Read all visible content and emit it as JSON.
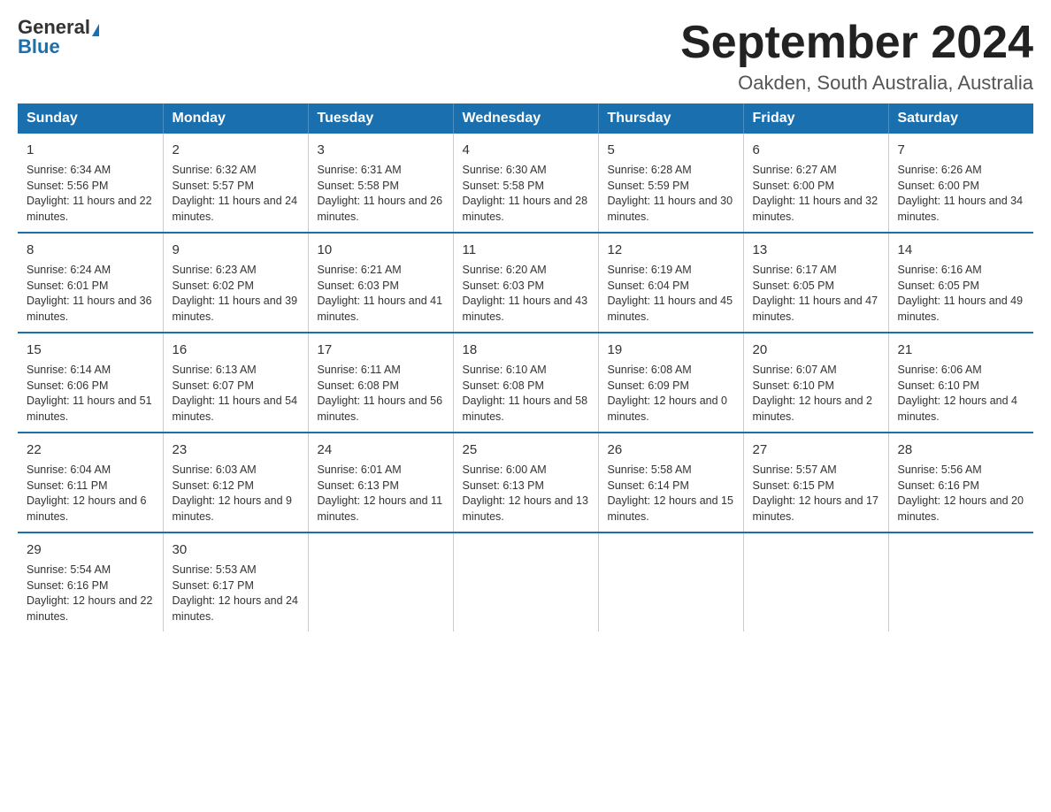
{
  "logo": {
    "general": "General",
    "blue": "Blue"
  },
  "title": "September 2024",
  "location": "Oakden, South Australia, Australia",
  "days_header": [
    "Sunday",
    "Monday",
    "Tuesday",
    "Wednesday",
    "Thursday",
    "Friday",
    "Saturday"
  ],
  "weeks": [
    [
      {
        "day": "1",
        "sunrise": "6:34 AM",
        "sunset": "5:56 PM",
        "daylight": "11 hours and 22 minutes."
      },
      {
        "day": "2",
        "sunrise": "6:32 AM",
        "sunset": "5:57 PM",
        "daylight": "11 hours and 24 minutes."
      },
      {
        "day": "3",
        "sunrise": "6:31 AM",
        "sunset": "5:58 PM",
        "daylight": "11 hours and 26 minutes."
      },
      {
        "day": "4",
        "sunrise": "6:30 AM",
        "sunset": "5:58 PM",
        "daylight": "11 hours and 28 minutes."
      },
      {
        "day": "5",
        "sunrise": "6:28 AM",
        "sunset": "5:59 PM",
        "daylight": "11 hours and 30 minutes."
      },
      {
        "day": "6",
        "sunrise": "6:27 AM",
        "sunset": "6:00 PM",
        "daylight": "11 hours and 32 minutes."
      },
      {
        "day": "7",
        "sunrise": "6:26 AM",
        "sunset": "6:00 PM",
        "daylight": "11 hours and 34 minutes."
      }
    ],
    [
      {
        "day": "8",
        "sunrise": "6:24 AM",
        "sunset": "6:01 PM",
        "daylight": "11 hours and 36 minutes."
      },
      {
        "day": "9",
        "sunrise": "6:23 AM",
        "sunset": "6:02 PM",
        "daylight": "11 hours and 39 minutes."
      },
      {
        "day": "10",
        "sunrise": "6:21 AM",
        "sunset": "6:03 PM",
        "daylight": "11 hours and 41 minutes."
      },
      {
        "day": "11",
        "sunrise": "6:20 AM",
        "sunset": "6:03 PM",
        "daylight": "11 hours and 43 minutes."
      },
      {
        "day": "12",
        "sunrise": "6:19 AM",
        "sunset": "6:04 PM",
        "daylight": "11 hours and 45 minutes."
      },
      {
        "day": "13",
        "sunrise": "6:17 AM",
        "sunset": "6:05 PM",
        "daylight": "11 hours and 47 minutes."
      },
      {
        "day": "14",
        "sunrise": "6:16 AM",
        "sunset": "6:05 PM",
        "daylight": "11 hours and 49 minutes."
      }
    ],
    [
      {
        "day": "15",
        "sunrise": "6:14 AM",
        "sunset": "6:06 PM",
        "daylight": "11 hours and 51 minutes."
      },
      {
        "day": "16",
        "sunrise": "6:13 AM",
        "sunset": "6:07 PM",
        "daylight": "11 hours and 54 minutes."
      },
      {
        "day": "17",
        "sunrise": "6:11 AM",
        "sunset": "6:08 PM",
        "daylight": "11 hours and 56 minutes."
      },
      {
        "day": "18",
        "sunrise": "6:10 AM",
        "sunset": "6:08 PM",
        "daylight": "11 hours and 58 minutes."
      },
      {
        "day": "19",
        "sunrise": "6:08 AM",
        "sunset": "6:09 PM",
        "daylight": "12 hours and 0 minutes."
      },
      {
        "day": "20",
        "sunrise": "6:07 AM",
        "sunset": "6:10 PM",
        "daylight": "12 hours and 2 minutes."
      },
      {
        "day": "21",
        "sunrise": "6:06 AM",
        "sunset": "6:10 PM",
        "daylight": "12 hours and 4 minutes."
      }
    ],
    [
      {
        "day": "22",
        "sunrise": "6:04 AM",
        "sunset": "6:11 PM",
        "daylight": "12 hours and 6 minutes."
      },
      {
        "day": "23",
        "sunrise": "6:03 AM",
        "sunset": "6:12 PM",
        "daylight": "12 hours and 9 minutes."
      },
      {
        "day": "24",
        "sunrise": "6:01 AM",
        "sunset": "6:13 PM",
        "daylight": "12 hours and 11 minutes."
      },
      {
        "day": "25",
        "sunrise": "6:00 AM",
        "sunset": "6:13 PM",
        "daylight": "12 hours and 13 minutes."
      },
      {
        "day": "26",
        "sunrise": "5:58 AM",
        "sunset": "6:14 PM",
        "daylight": "12 hours and 15 minutes."
      },
      {
        "day": "27",
        "sunrise": "5:57 AM",
        "sunset": "6:15 PM",
        "daylight": "12 hours and 17 minutes."
      },
      {
        "day": "28",
        "sunrise": "5:56 AM",
        "sunset": "6:16 PM",
        "daylight": "12 hours and 20 minutes."
      }
    ],
    [
      {
        "day": "29",
        "sunrise": "5:54 AM",
        "sunset": "6:16 PM",
        "daylight": "12 hours and 22 minutes."
      },
      {
        "day": "30",
        "sunrise": "5:53 AM",
        "sunset": "6:17 PM",
        "daylight": "12 hours and 24 minutes."
      },
      null,
      null,
      null,
      null,
      null
    ]
  ]
}
